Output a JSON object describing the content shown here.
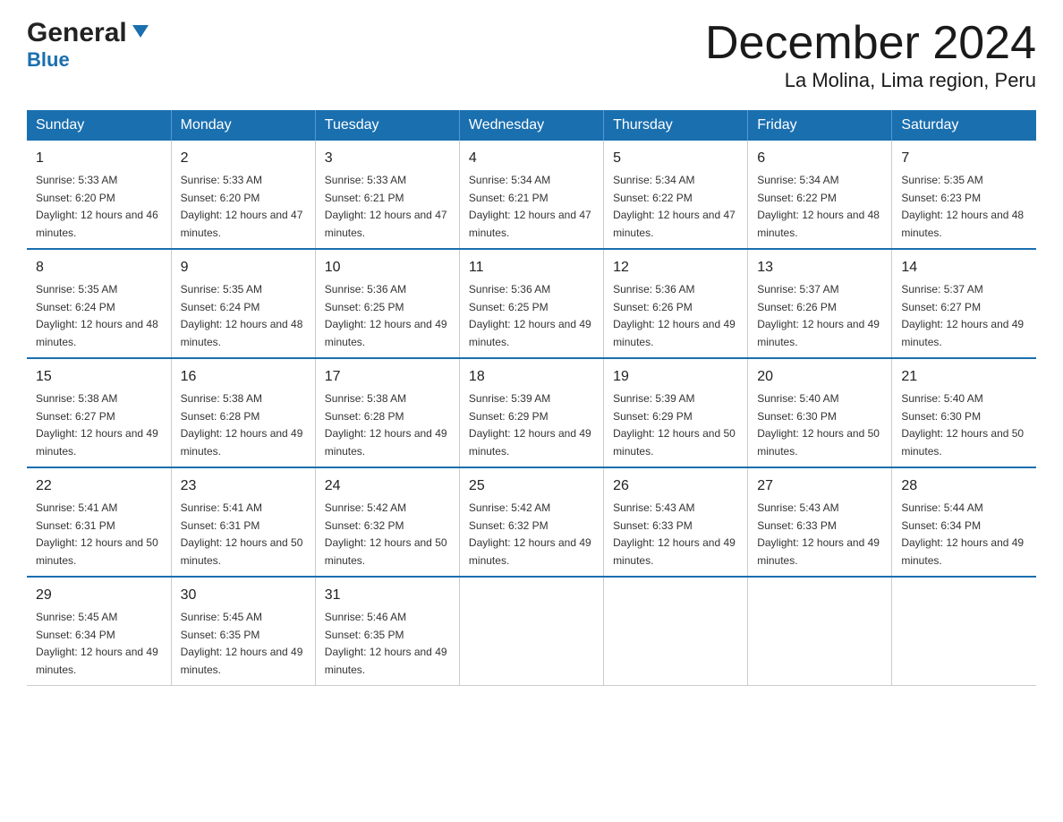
{
  "header": {
    "logo_general": "General",
    "logo_blue": "Blue",
    "title": "December 2024",
    "subtitle": "La Molina, Lima region, Peru"
  },
  "weekdays": [
    "Sunday",
    "Monday",
    "Tuesday",
    "Wednesday",
    "Thursday",
    "Friday",
    "Saturday"
  ],
  "weeks": [
    [
      {
        "day": "1",
        "sunrise": "5:33 AM",
        "sunset": "6:20 PM",
        "daylight": "12 hours and 46 minutes."
      },
      {
        "day": "2",
        "sunrise": "5:33 AM",
        "sunset": "6:20 PM",
        "daylight": "12 hours and 47 minutes."
      },
      {
        "day": "3",
        "sunrise": "5:33 AM",
        "sunset": "6:21 PM",
        "daylight": "12 hours and 47 minutes."
      },
      {
        "day": "4",
        "sunrise": "5:34 AM",
        "sunset": "6:21 PM",
        "daylight": "12 hours and 47 minutes."
      },
      {
        "day": "5",
        "sunrise": "5:34 AM",
        "sunset": "6:22 PM",
        "daylight": "12 hours and 47 minutes."
      },
      {
        "day": "6",
        "sunrise": "5:34 AM",
        "sunset": "6:22 PM",
        "daylight": "12 hours and 48 minutes."
      },
      {
        "day": "7",
        "sunrise": "5:35 AM",
        "sunset": "6:23 PM",
        "daylight": "12 hours and 48 minutes."
      }
    ],
    [
      {
        "day": "8",
        "sunrise": "5:35 AM",
        "sunset": "6:24 PM",
        "daylight": "12 hours and 48 minutes."
      },
      {
        "day": "9",
        "sunrise": "5:35 AM",
        "sunset": "6:24 PM",
        "daylight": "12 hours and 48 minutes."
      },
      {
        "day": "10",
        "sunrise": "5:36 AM",
        "sunset": "6:25 PM",
        "daylight": "12 hours and 49 minutes."
      },
      {
        "day": "11",
        "sunrise": "5:36 AM",
        "sunset": "6:25 PM",
        "daylight": "12 hours and 49 minutes."
      },
      {
        "day": "12",
        "sunrise": "5:36 AM",
        "sunset": "6:26 PM",
        "daylight": "12 hours and 49 minutes."
      },
      {
        "day": "13",
        "sunrise": "5:37 AM",
        "sunset": "6:26 PM",
        "daylight": "12 hours and 49 minutes."
      },
      {
        "day": "14",
        "sunrise": "5:37 AM",
        "sunset": "6:27 PM",
        "daylight": "12 hours and 49 minutes."
      }
    ],
    [
      {
        "day": "15",
        "sunrise": "5:38 AM",
        "sunset": "6:27 PM",
        "daylight": "12 hours and 49 minutes."
      },
      {
        "day": "16",
        "sunrise": "5:38 AM",
        "sunset": "6:28 PM",
        "daylight": "12 hours and 49 minutes."
      },
      {
        "day": "17",
        "sunrise": "5:38 AM",
        "sunset": "6:28 PM",
        "daylight": "12 hours and 49 minutes."
      },
      {
        "day": "18",
        "sunrise": "5:39 AM",
        "sunset": "6:29 PM",
        "daylight": "12 hours and 49 minutes."
      },
      {
        "day": "19",
        "sunrise": "5:39 AM",
        "sunset": "6:29 PM",
        "daylight": "12 hours and 50 minutes."
      },
      {
        "day": "20",
        "sunrise": "5:40 AM",
        "sunset": "6:30 PM",
        "daylight": "12 hours and 50 minutes."
      },
      {
        "day": "21",
        "sunrise": "5:40 AM",
        "sunset": "6:30 PM",
        "daylight": "12 hours and 50 minutes."
      }
    ],
    [
      {
        "day": "22",
        "sunrise": "5:41 AM",
        "sunset": "6:31 PM",
        "daylight": "12 hours and 50 minutes."
      },
      {
        "day": "23",
        "sunrise": "5:41 AM",
        "sunset": "6:31 PM",
        "daylight": "12 hours and 50 minutes."
      },
      {
        "day": "24",
        "sunrise": "5:42 AM",
        "sunset": "6:32 PM",
        "daylight": "12 hours and 50 minutes."
      },
      {
        "day": "25",
        "sunrise": "5:42 AM",
        "sunset": "6:32 PM",
        "daylight": "12 hours and 49 minutes."
      },
      {
        "day": "26",
        "sunrise": "5:43 AM",
        "sunset": "6:33 PM",
        "daylight": "12 hours and 49 minutes."
      },
      {
        "day": "27",
        "sunrise": "5:43 AM",
        "sunset": "6:33 PM",
        "daylight": "12 hours and 49 minutes."
      },
      {
        "day": "28",
        "sunrise": "5:44 AM",
        "sunset": "6:34 PM",
        "daylight": "12 hours and 49 minutes."
      }
    ],
    [
      {
        "day": "29",
        "sunrise": "5:45 AM",
        "sunset": "6:34 PM",
        "daylight": "12 hours and 49 minutes."
      },
      {
        "day": "30",
        "sunrise": "5:45 AM",
        "sunset": "6:35 PM",
        "daylight": "12 hours and 49 minutes."
      },
      {
        "day": "31",
        "sunrise": "5:46 AM",
        "sunset": "6:35 PM",
        "daylight": "12 hours and 49 minutes."
      },
      {
        "day": "",
        "sunrise": "",
        "sunset": "",
        "daylight": ""
      },
      {
        "day": "",
        "sunrise": "",
        "sunset": "",
        "daylight": ""
      },
      {
        "day": "",
        "sunrise": "",
        "sunset": "",
        "daylight": ""
      },
      {
        "day": "",
        "sunrise": "",
        "sunset": "",
        "daylight": ""
      }
    ]
  ],
  "labels": {
    "sunrise_prefix": "Sunrise: ",
    "sunset_prefix": "Sunset: ",
    "daylight_prefix": "Daylight: "
  }
}
